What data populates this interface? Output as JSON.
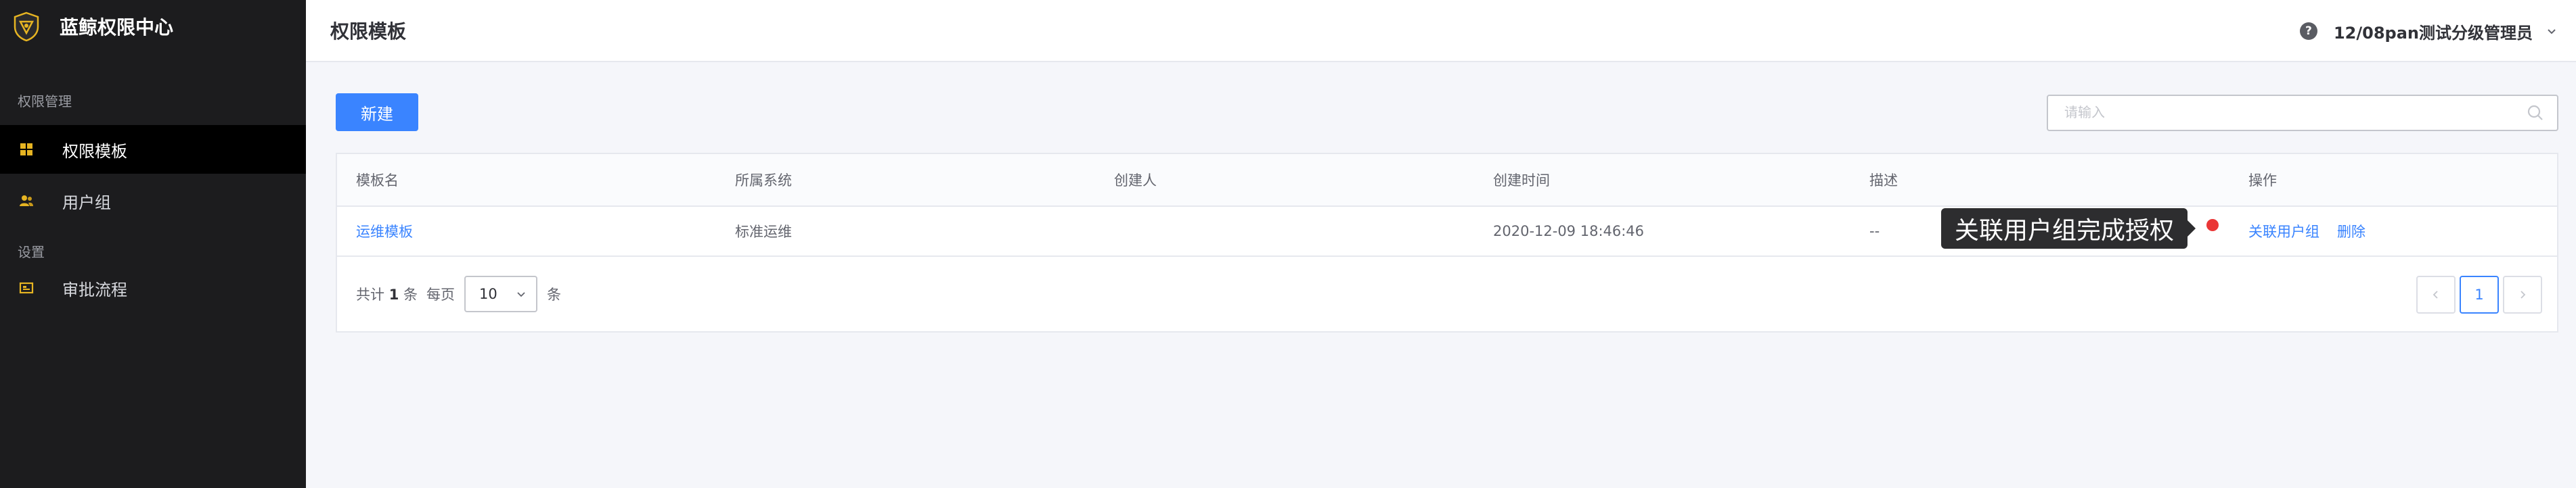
{
  "app": {
    "name": "蓝鲸权限中心"
  },
  "sidebar": {
    "groups": [
      {
        "title": "权限管理",
        "items": [
          {
            "label": "权限模板",
            "icon": "grid-icon",
            "active": true
          },
          {
            "label": "用户组",
            "icon": "users-icon",
            "active": false
          }
        ]
      },
      {
        "title": "设置",
        "items": [
          {
            "label": "审批流程",
            "icon": "workflow-icon",
            "active": false
          }
        ]
      }
    ]
  },
  "header": {
    "title": "权限模板",
    "help_icon": "?",
    "user": "12/08pan测试分级管理员"
  },
  "toolbar": {
    "new_label": "新建",
    "search_placeholder": "请输入"
  },
  "table": {
    "columns": [
      "模板名",
      "所属系统",
      "创建人",
      "创建时间",
      "描述",
      "操作"
    ],
    "rows": [
      {
        "name": "运维模板",
        "system": "标准运维",
        "creator": "",
        "created_at": "2020-12-09 18:46:46",
        "description": "--",
        "actions": [
          "关联用户组",
          "删除"
        ]
      }
    ]
  },
  "tooltip": {
    "text": "关联用户组完成授权"
  },
  "pagination": {
    "total_prefix": "共计",
    "total": "1",
    "total_suffix": "条",
    "per_page_label": "每页",
    "per_page_value": "10",
    "per_page_unit": "条",
    "current_page": "1"
  },
  "colors": {
    "primary": "#3a84ff",
    "sidebar_bg": "#1c1c1e",
    "sidebar_active": "#000000",
    "logo_gold": "#e6b422",
    "alert_dot": "#ea3636"
  }
}
